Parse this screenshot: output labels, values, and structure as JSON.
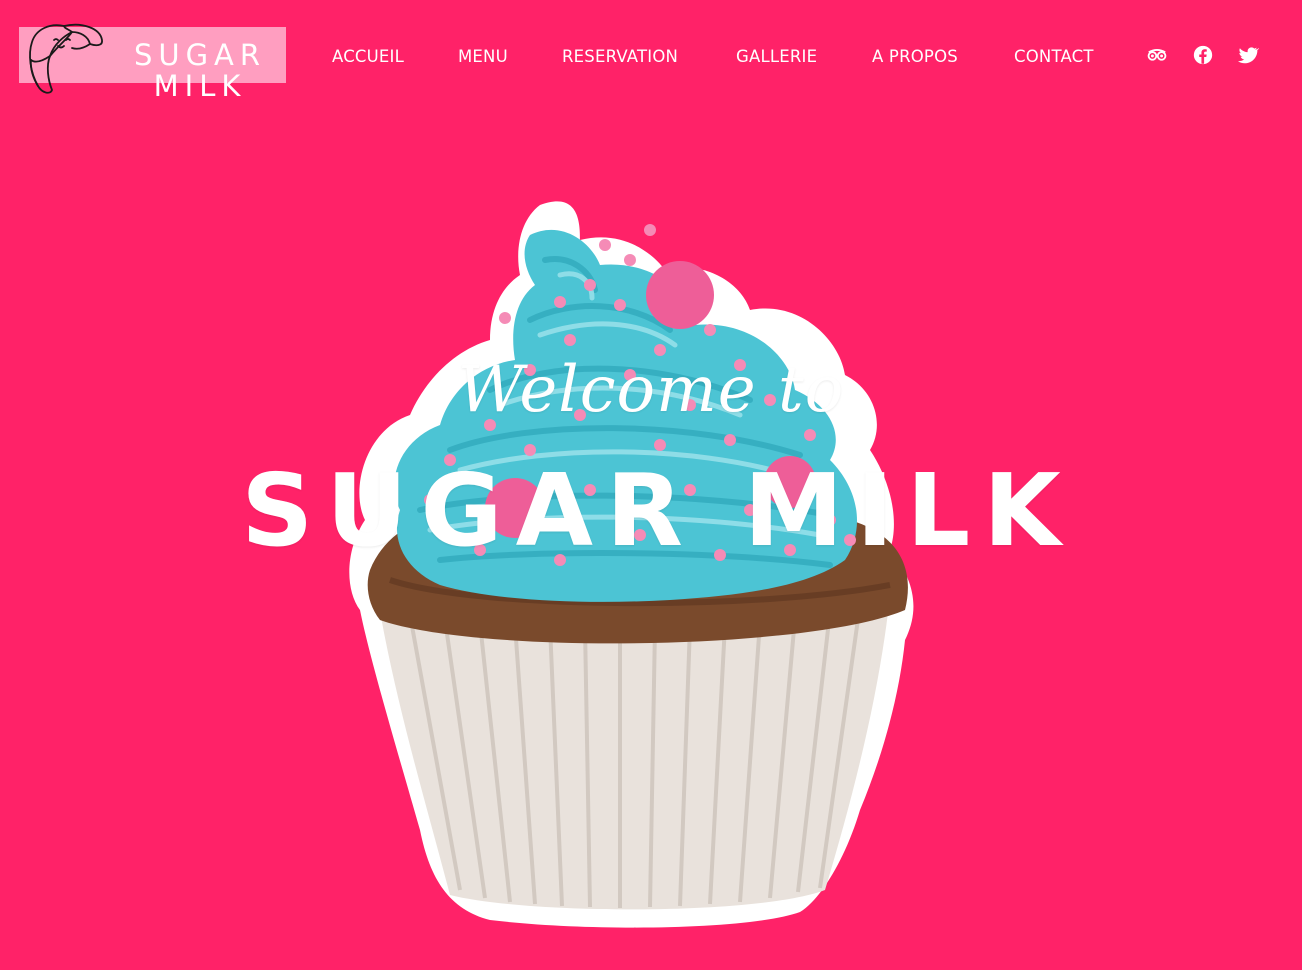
{
  "brand": {
    "line1": "SUGAR",
    "line2": "MILK",
    "icon": "croissant-icon"
  },
  "nav": {
    "items": [
      {
        "label": "ACCUEIL"
      },
      {
        "label": "MENU"
      },
      {
        "label": "RESERVATION"
      },
      {
        "label": "GALLERIE"
      },
      {
        "label": "A PROPOS"
      },
      {
        "label": "CONTACT"
      }
    ]
  },
  "social": [
    {
      "icon": "tripadvisor-icon"
    },
    {
      "icon": "facebook-icon"
    },
    {
      "icon": "twitter-icon"
    }
  ],
  "hero": {
    "welcome": "Welcome to",
    "title": "SUGAR MILK",
    "image": "cupcake-image"
  },
  "colors": {
    "background": "#ff2268",
    "logo_box": "#ff9ec0",
    "text": "#ffffff",
    "frosting": "#4cc4d4",
    "sprinkles": "#f58bb6",
    "cake": "#7a4a2c",
    "wrapper": "#e9e2dc"
  }
}
